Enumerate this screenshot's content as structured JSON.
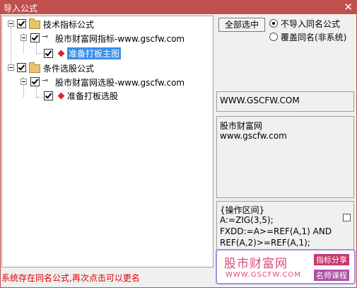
{
  "window": {
    "title": "导入公式",
    "close": "✕"
  },
  "tree": {
    "groups": [
      {
        "label": "技术指标公式",
        "child": "股市财富网指标-www.gscfw.com",
        "leaf": "准备打板主图"
      },
      {
        "label": "条件选股公式",
        "child": "股市财富网选股-www.gscfw.com",
        "leaf": "准备打板选股"
      }
    ]
  },
  "controls": {
    "select_all": "全部选中",
    "radio_skip": "不导入同名公式",
    "radio_overwrite": "覆盖同名(非系统)"
  },
  "info": {
    "site": "WWW.GSCFW.COM",
    "desc_line1": "股市财富网",
    "desc_line2": "www.gscfw.com",
    "code_line1": "{操作区间}",
    "code_line2": "A:=ZIG(3,5);",
    "code_line3": "FXDD:=A>=REF(A,1) AND",
    "code_line4": "REF(A,2)>=REF(A,1);"
  },
  "status": "系统存在同名公式,再次点击可以更名",
  "watermark": {
    "brand": "股市财富网",
    "url": "WWW.GSCFW.COM",
    "tag1": "指标分享",
    "tag2": "名师课程"
  }
}
